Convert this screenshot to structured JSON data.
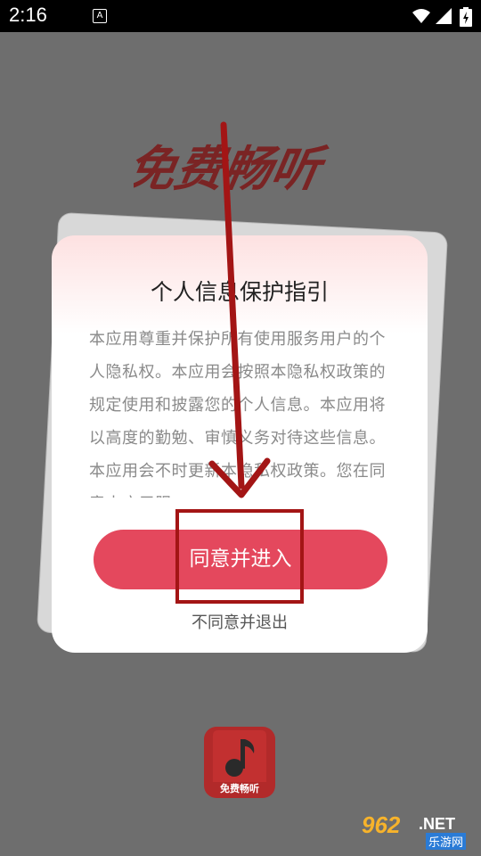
{
  "status_bar": {
    "time": "2:16",
    "notification_icon_text": "A",
    "icons": [
      "wifi-icon",
      "signal-icon",
      "battery-icon"
    ]
  },
  "splash": {
    "title_art": "免费畅听"
  },
  "dialog": {
    "title": "个人信息保护指引",
    "body": "本应用尊重并保护所有使用服务用户的个人隐私权。本应用会按照本隐私权政策的规定使用和披露您的个人信息。本应用将以高度的勤勉、审慎义务对待这些信息。本应用会不时更新本隐私权政策。您在同意本应用服",
    "agree_label": "同意并进入",
    "decline_label": "不同意并退出"
  },
  "app_icon": {
    "label": "免费畅听",
    "icon": "music-note-icon"
  },
  "watermark": {
    "number": "962",
    "domain": ".NET",
    "site_name": "乐游网"
  },
  "colors": {
    "accent": "#e4485d",
    "annotation": "#a31515",
    "overlay": "#6e6e6e"
  }
}
